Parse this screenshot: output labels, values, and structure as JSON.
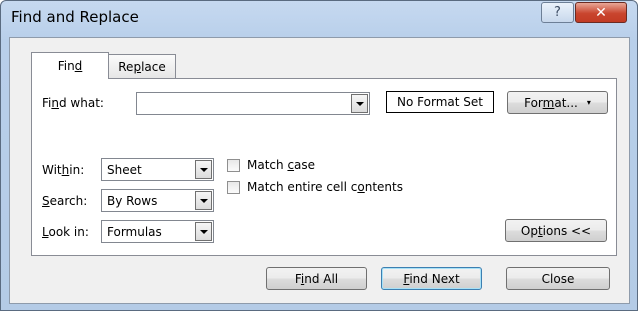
{
  "window": {
    "title": "Find and Replace",
    "help_icon": "?",
    "close_icon": "✕"
  },
  "tabs": {
    "find": "Find",
    "replace": "Replace"
  },
  "find_what": {
    "label": "Find what:",
    "value": ""
  },
  "format_status": "No Format Set",
  "buttons": {
    "format": "Format...",
    "options": "Options <<",
    "find_all": "Find All",
    "find_next": "Find Next",
    "close": "Close"
  },
  "within": {
    "label": "Within:",
    "value": "Sheet"
  },
  "search": {
    "label": "Search:",
    "value": "By Rows"
  },
  "look_in": {
    "label": "Look in:",
    "value": "Formulas"
  },
  "checkboxes": {
    "match_case": {
      "label": "Match case",
      "checked": false
    },
    "match_entire": {
      "label": "Match entire cell contents",
      "checked": false
    }
  }
}
